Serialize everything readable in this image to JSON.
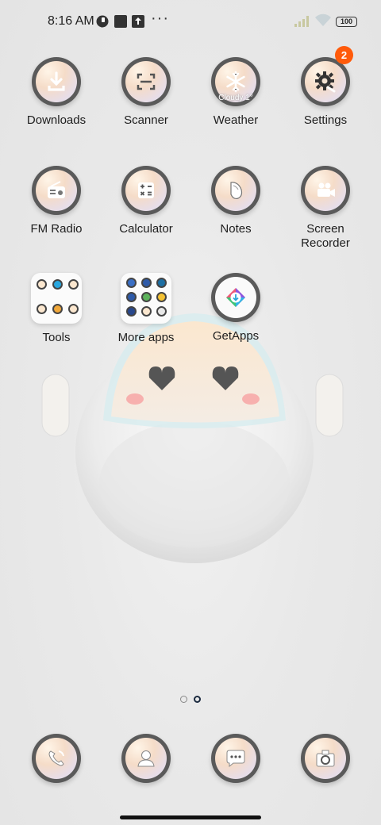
{
  "status_bar": {
    "time": "8:16 AM",
    "more": "···",
    "battery": "100"
  },
  "apps": [
    {
      "label": "Downloads"
    },
    {
      "label": "Scanner"
    },
    {
      "label": "Weather",
      "temp": "Cloudy 1°"
    },
    {
      "label": "Settings",
      "badge": "2"
    },
    {
      "label": "FM Radio"
    },
    {
      "label": "Calculator"
    },
    {
      "label": "Notes"
    },
    {
      "label": "Screen Recorder"
    },
    {
      "label": "Tools"
    },
    {
      "label": "More apps"
    },
    {
      "label": "GetApps"
    }
  ],
  "page_indicator": {
    "pages": 2,
    "current": 2
  },
  "colors": {
    "badge": "#ff5a0a",
    "icon_ring": "#5a5a5a",
    "page_dot_active": "#1b2a3f"
  }
}
